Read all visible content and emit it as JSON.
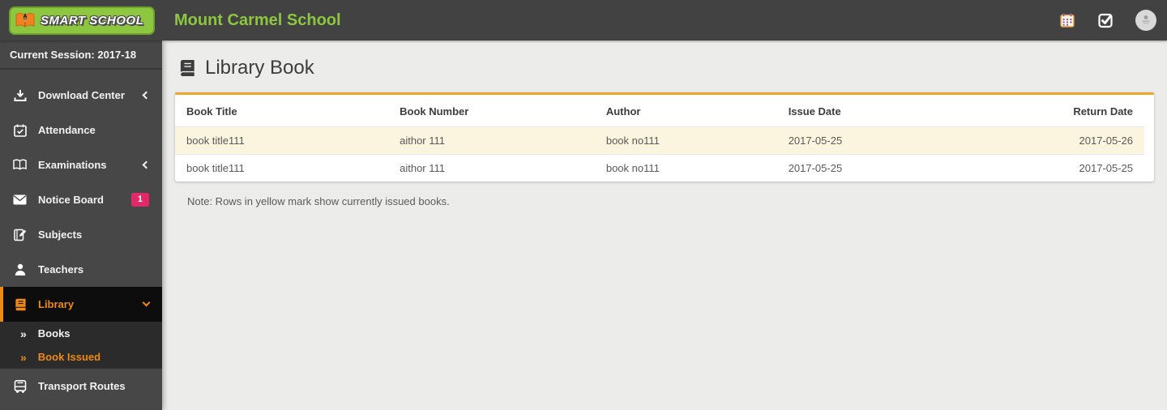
{
  "brand": {
    "logo_text": "SMART SCHOOL",
    "logo_icon": "open-book-pen-icon",
    "school_name": "Mount Carmel School",
    "green": "#8dc63f"
  },
  "header": {
    "icons": [
      {
        "name": "calendar-icon"
      },
      {
        "name": "task-check-icon"
      },
      {
        "name": "user-avatar"
      }
    ]
  },
  "sidebar": {
    "session_label": "Current Session: 2017-18",
    "active_color": "#ef8914",
    "items": [
      {
        "label": "Download Center",
        "icon": "download-icon",
        "chevron": "left"
      },
      {
        "label": "Attendance",
        "icon": "calendar-check-icon"
      },
      {
        "label": "Examinations",
        "icon": "open-book-icon",
        "chevron": "left"
      },
      {
        "label": "Notice Board",
        "icon": "envelope-icon",
        "badge": "1",
        "badge_color": "#e3286a"
      },
      {
        "label": "Subjects",
        "icon": "book-pencil-icon"
      },
      {
        "label": "Teachers",
        "icon": "person-icon"
      },
      {
        "label": "Library",
        "icon": "book-icon",
        "chevron": "down",
        "active": true,
        "children": [
          {
            "label": "Books",
            "icon": "angle-double-right-icon",
            "active": false
          },
          {
            "label": "Book Issued",
            "icon": "angle-double-right-icon",
            "active": true
          }
        ]
      },
      {
        "label": "Transport Routes",
        "icon": "bus-icon"
      }
    ]
  },
  "main": {
    "page_title": "Library Book",
    "title_icon": "book-icon",
    "accent_color": "#f0a42e",
    "highlight_color": "#fbf5df",
    "table": {
      "columns": [
        "Book Title",
        "Book Number",
        "Author",
        "Issue Date",
        "Return Date"
      ],
      "rows": [
        {
          "highlighted": true,
          "cells": [
            "book title111",
            "aithor 111",
            "book no111",
            "2017-05-25",
            "2017-05-26"
          ]
        },
        {
          "highlighted": false,
          "cells": [
            "book title111",
            "aithor 111",
            "book no111",
            "2017-05-25",
            "2017-05-25"
          ]
        }
      ]
    },
    "note": "Note: Rows in yellow mark show currently issued books."
  }
}
